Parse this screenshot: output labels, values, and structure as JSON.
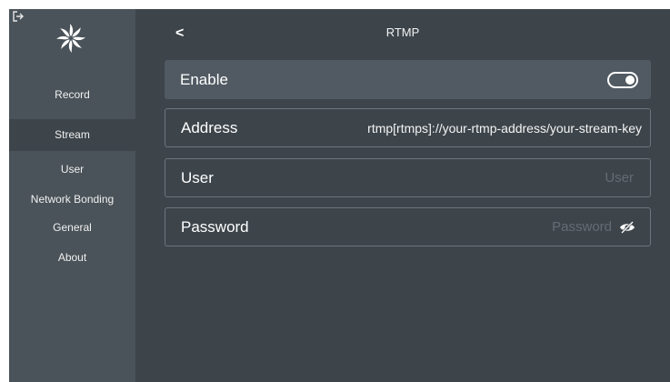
{
  "sidebar": {
    "items": [
      {
        "label": "Record"
      },
      {
        "label": "Stream",
        "active": true
      },
      {
        "label": "User"
      },
      {
        "label": "Network Bonding"
      },
      {
        "label": "General"
      },
      {
        "label": "About"
      }
    ]
  },
  "header": {
    "back": "<",
    "title": "RTMP"
  },
  "enable": {
    "label": "Enable",
    "toggle_on": true
  },
  "address": {
    "label": "Address",
    "value": "rtmp[rtmps]://your-rtmp-address/your-stream-key"
  },
  "user": {
    "label": "User",
    "placeholder": "User",
    "value": ""
  },
  "password": {
    "label": "Password",
    "placeholder": "Password",
    "value": ""
  },
  "colors": {
    "background": "#3d454b",
    "sidebar": "#4a5359",
    "row_fill": "#515a62",
    "border": "#6b757c"
  },
  "icons": [
    "logout-icon",
    "logo-icon",
    "back-icon",
    "toggle-switch",
    "eye-hidden-icon"
  ]
}
